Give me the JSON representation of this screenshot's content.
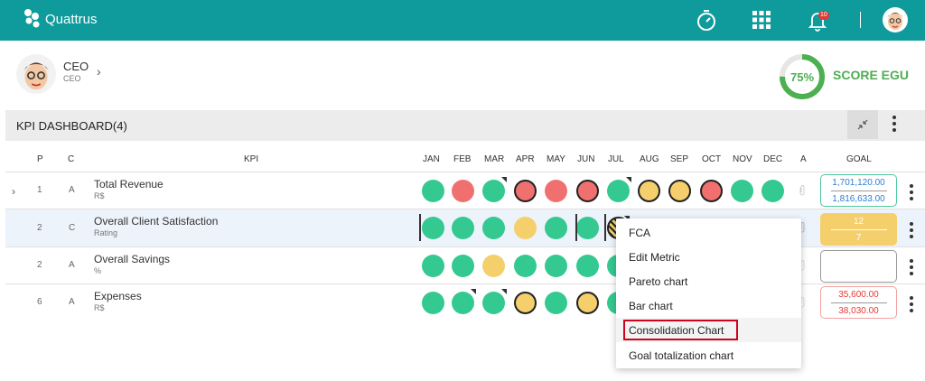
{
  "app": {
    "name": "Quattrus",
    "notifications": "10"
  },
  "user": {
    "name": "CEO",
    "role": "CEO"
  },
  "score": {
    "value": "75%",
    "label": "SCORE EGU"
  },
  "dashboard": {
    "title": "KPI DASHBOARD(4)",
    "columns": {
      "p": "P",
      "c": "C",
      "kpi": "KPI",
      "a": "A",
      "goal": "GOAL",
      "months": [
        "JAN",
        "FEB",
        "MAR",
        "APR",
        "MAY",
        "JUN",
        "JUL",
        "AUG",
        "SEP",
        "OCT",
        "NOV",
        "DEC"
      ]
    },
    "rows": [
      {
        "p": "1",
        "c": "A",
        "name": "Total Revenue",
        "unit": "R$",
        "statuses": [
          "green",
          "red",
          "green",
          "red",
          "red",
          "red",
          "green",
          "yellow",
          "yellow",
          "red",
          "green",
          "green"
        ],
        "goal_top": "1,701,120.00",
        "goal_bottom": "1,816,633.00",
        "goal_color": "green"
      },
      {
        "p": "2",
        "c": "C",
        "name": "Overall Client Satisfaction",
        "unit": "Rating",
        "statuses": [
          "green",
          "green",
          "green",
          "yellow",
          "green",
          "green",
          "yellow"
        ],
        "goal_top": "12",
        "goal_bottom": "7",
        "goal_color": "yellow"
      },
      {
        "p": "2",
        "c": "A",
        "name": "Overall Savings",
        "unit": "%",
        "statuses": [
          "green",
          "green",
          "yellow",
          "green",
          "green",
          "green",
          "green"
        ],
        "goal_top": "",
        "goal_bottom": "",
        "goal_color": "gray"
      },
      {
        "p": "6",
        "c": "A",
        "name": "Expenses",
        "unit": "R$",
        "statuses": [
          "green",
          "green",
          "green",
          "yellow",
          "green",
          "yellow",
          "green"
        ],
        "goal_top": "35,600.00",
        "goal_bottom": "38,030.00",
        "goal_color": "red"
      }
    ]
  },
  "context_menu": {
    "items": [
      "FCA",
      "Edit Metric",
      "Pareto chart",
      "Bar chart",
      "Consolidation Chart",
      "Goal totalization chart"
    ],
    "highlighted": "Consolidation Chart"
  }
}
